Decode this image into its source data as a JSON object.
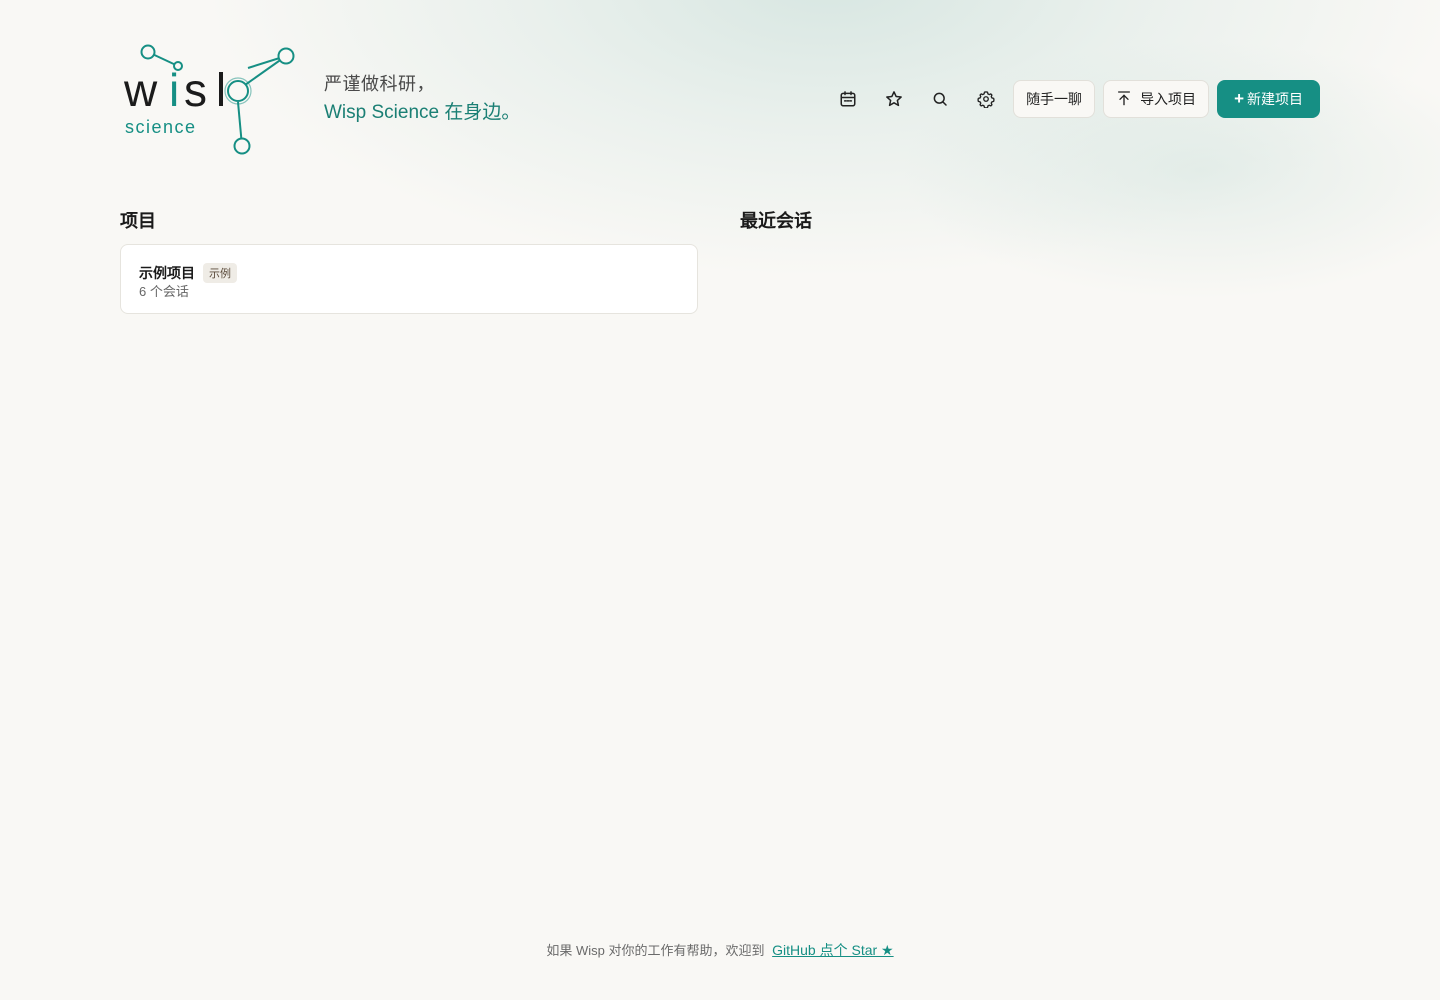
{
  "brand": {
    "logo_word": "wisp",
    "logo_sub": "science",
    "tagline_line1": "严谨做科研，",
    "tagline_line2": "Wisp Science 在身边。",
    "accent_color": "#168f84"
  },
  "toolbar": {
    "icons": [
      "calendar-icon",
      "star-icon",
      "search-icon",
      "gear-icon"
    ],
    "chat_label": "随手一聊",
    "import_label": "导入项目",
    "new_project_label": "新建项目",
    "new_project_plus": "+"
  },
  "projects": {
    "title": "项目",
    "items": [
      {
        "name": "示例项目",
        "badge": "示例",
        "meta": "6 个会话"
      }
    ]
  },
  "recent": {
    "title": "最近会话"
  },
  "footer": {
    "text": "如果 Wisp 对你的工作有帮助，欢迎到",
    "link": "GitHub 点个 Star ★"
  }
}
